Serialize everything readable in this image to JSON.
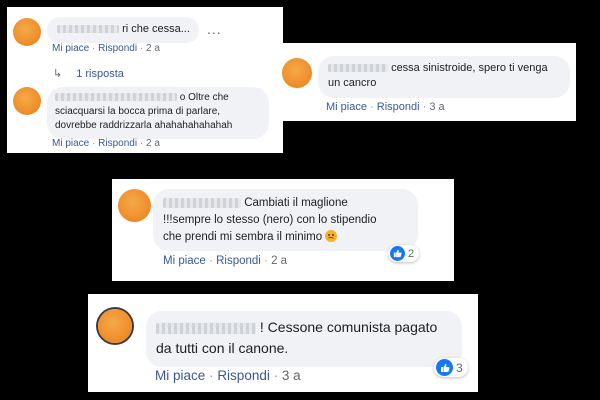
{
  "comments": [
    {
      "text_visible": "ri che cessa...",
      "more": "...",
      "actions": {
        "like": "Mi piace",
        "reply": "Rispondi",
        "sep": "·",
        "time": "2 a"
      },
      "replies_link": "1 risposta"
    },
    {
      "text_line1": "o Oltre che",
      "text_line2": "sciacquarsi la bocca prima di parlare,",
      "text_line3": "dovrebbe raddrizzarla ahahahahahahah",
      "actions": {
        "like": "Mi piace",
        "reply": "Rispondi",
        "sep": "·",
        "time": "2 a"
      }
    },
    {
      "text_line1": "cessa sinistroide, spero ti venga",
      "text_line2": "un cancro",
      "actions": {
        "like": "Mi piace",
        "reply": "Rispondi",
        "sep": "·",
        "time": "3 a"
      }
    },
    {
      "text_line1": "Cambiati il maglione",
      "text_line2": "!!!sempre lo stesso (nero) con lo stipendio",
      "text_line3": "che prendi mi sembra il minimo",
      "emoji": "angry-face-icon",
      "actions": {
        "like": "Mi piace",
        "reply": "Rispondi",
        "sep": "·",
        "time": "2 a"
      },
      "reactions": {
        "type": "like",
        "count": "2",
        "color": "#1877f2"
      }
    },
    {
      "text_line1": "! Cessone comunista pagato",
      "text_line2": "da tutti con il canone.",
      "actions": {
        "like": "Mi piace",
        "reply": "Rispondi",
        "sep": "·",
        "time": "3 a"
      },
      "reactions": {
        "type": "like",
        "count": "3",
        "color": "#1877f2"
      }
    }
  ],
  "colors": {
    "background": "#000000",
    "bubble": "#f0f2f5",
    "link": "#385898",
    "avatar": "#ef8f2c"
  }
}
